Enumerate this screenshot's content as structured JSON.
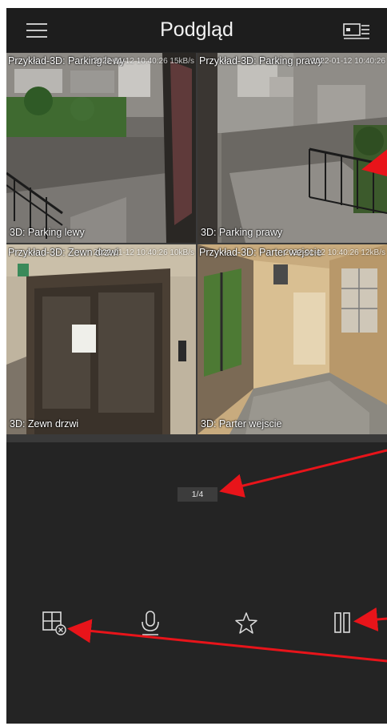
{
  "header": {
    "title": "Podgląd"
  },
  "tiles": [
    {
      "overlay": "Przykład-3D: Parking lewy",
      "stamp": "2022-01-12 10:40:26",
      "rate": "15kB/s",
      "name": "3D: Parking lewy"
    },
    {
      "overlay": "Przykład-3D: Parking prawy",
      "stamp": "2022-01-12 10:40:26",
      "rate": "",
      "name": "3D: Parking prawy"
    },
    {
      "overlay": "Przykład-3D: Zewn drzwi",
      "stamp": "2022-01-12 10:40:26",
      "rate": "10kB/s",
      "name": "3D: Zewn drzwi"
    },
    {
      "overlay": "Przykład-3D: Parter wejscie",
      "stamp": "2022-01-12 10:40:26",
      "rate": "12kB/s",
      "name": "3D: Parter wejscie"
    }
  ],
  "pager": {
    "text": "1/4"
  },
  "toolbar": {
    "icons": [
      "layout-close-icon",
      "microphone-icon",
      "star-icon",
      "pause-icon"
    ]
  },
  "colors": {
    "background": "#242424",
    "header": "#1d1d1d",
    "accent": "#3c82d8",
    "annotation_arrow": "#e8141a"
  }
}
